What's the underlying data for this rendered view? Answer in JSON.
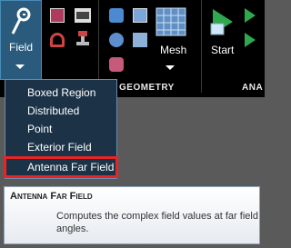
{
  "ribbon": {
    "field_label": "Field",
    "mesh_label": "Mesh",
    "start_label": "Start",
    "geometry_group_label": "GEOMETRY",
    "analysis_group_label": "ANA"
  },
  "menu": {
    "items": [
      {
        "label": "Boxed Region"
      },
      {
        "label": "Distributed"
      },
      {
        "label": "Point"
      },
      {
        "label": "Exterior Field"
      },
      {
        "label": "Antenna Far Field"
      }
    ]
  },
  "tooltip": {
    "title": "Antenna Far Field",
    "body": "Computes the complex field values at far field angles."
  }
}
